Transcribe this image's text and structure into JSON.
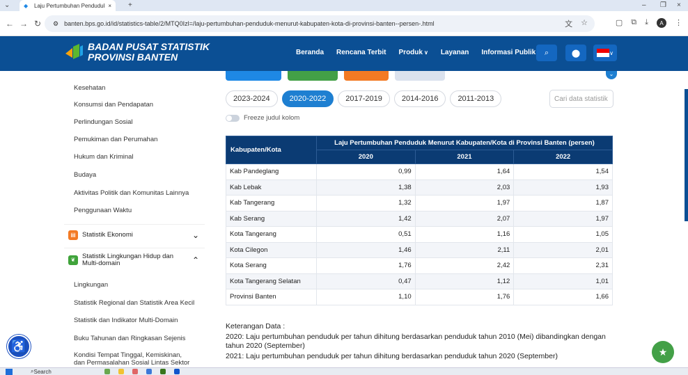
{
  "browser": {
    "tab_title": "Laju Pertumbuhan Penduduk M",
    "url": "banten.bps.go.id/id/statistics-table/2/MTQ0Izl=/laju-pertumbuhan-penduduk-menurut-kabupaten-kota-di-provinsi-banten--persen-.html",
    "profile_initial": "A"
  },
  "header": {
    "logo_line1": "BADAN PUSAT STATISTIK",
    "logo_line2": "PROVINSI BANTEN",
    "menu": [
      "Beranda",
      "Rencana Terbit",
      "Produk",
      "Layanan",
      "Informasi Publik"
    ]
  },
  "sidebar": {
    "items_top": [
      "Kesehatan",
      "Konsumsi dan Pendapatan",
      "Perlindungan Sosial",
      "Pemukiman dan Perumahan",
      "Hukum dan Kriminal",
      "Budaya",
      "Aktivitas Politik dan Komunitas Lainnya",
      "Penggunaan Waktu"
    ],
    "cat_ekonomi": "Statistik Ekonomi",
    "cat_lingkungan_1": "Statistik Lingkungan Hidup dan",
    "cat_lingkungan_2": "Multi-domain",
    "items_bottom": [
      "Lingkungan",
      "Statistik Regional dan Statistik Area Kecil",
      "Statistik dan Indikator Multi-Domain",
      "Buku Tahunan dan Ringkasan Sejenis"
    ],
    "item_last_1": "Kondisi Tempat Tinggal, Kemiskinan,",
    "item_last_2": "dan Permasalahan Sosial Lintas Sektor"
  },
  "year_tabs": [
    "2023-2024",
    "2020-2022",
    "2017-2019",
    "2014-2016",
    "2011-2013"
  ],
  "active_year_tab": "2020-2022",
  "search_placeholder": "Cari data statistik",
  "freeze_label": "Freeze judul kolom",
  "table": {
    "col_kab": "Kabupaten/Kota",
    "col_group": "Laju Pertumbuhan Penduduk Menurut Kabupaten/Kota di Provinsi Banten (persen)",
    "years": [
      "2020",
      "2021",
      "2022"
    ],
    "rows": [
      {
        "name": "Kab Pandeglang",
        "v": [
          "0,99",
          "1,64",
          "1,54"
        ]
      },
      {
        "name": "Kab Lebak",
        "v": [
          "1,38",
          "2,03",
          "1,93"
        ]
      },
      {
        "name": "Kab Tangerang",
        "v": [
          "1,32",
          "1,97",
          "1,87"
        ]
      },
      {
        "name": "Kab Serang",
        "v": [
          "1,42",
          "2,07",
          "1,97"
        ]
      },
      {
        "name": "Kota Tangerang",
        "v": [
          "0,51",
          "1,16",
          "1,05"
        ]
      },
      {
        "name": "Kota Cilegon",
        "v": [
          "1,46",
          "2,11",
          "2,01"
        ]
      },
      {
        "name": "Kota Serang",
        "v": [
          "1,76",
          "2,42",
          "2,31"
        ]
      },
      {
        "name": "Kota Tangerang Selatan",
        "v": [
          "0,47",
          "1,12",
          "1,01"
        ]
      },
      {
        "name": "Provinsi Banten",
        "v": [
          "1,10",
          "1,76",
          "1,66"
        ]
      }
    ]
  },
  "notes": {
    "heading": "Keterangan Data :",
    "line1": "2020: Laju pertumbuhan penduduk per tahun dihitung berdasarkan penduduk tahun 2010 (Mei) dibandingkan dengan tahun 2020 (September)",
    "line2": "2021: Laju pertumbuhan penduduk per tahun dihitung berdasarkan penduduk tahun 2020 (September)"
  },
  "taskbar": {
    "search": "Search"
  },
  "colors": {
    "header": "#0b4f94",
    "table_header": "#0b3b73",
    "active_tab": "#1e7fd1"
  }
}
